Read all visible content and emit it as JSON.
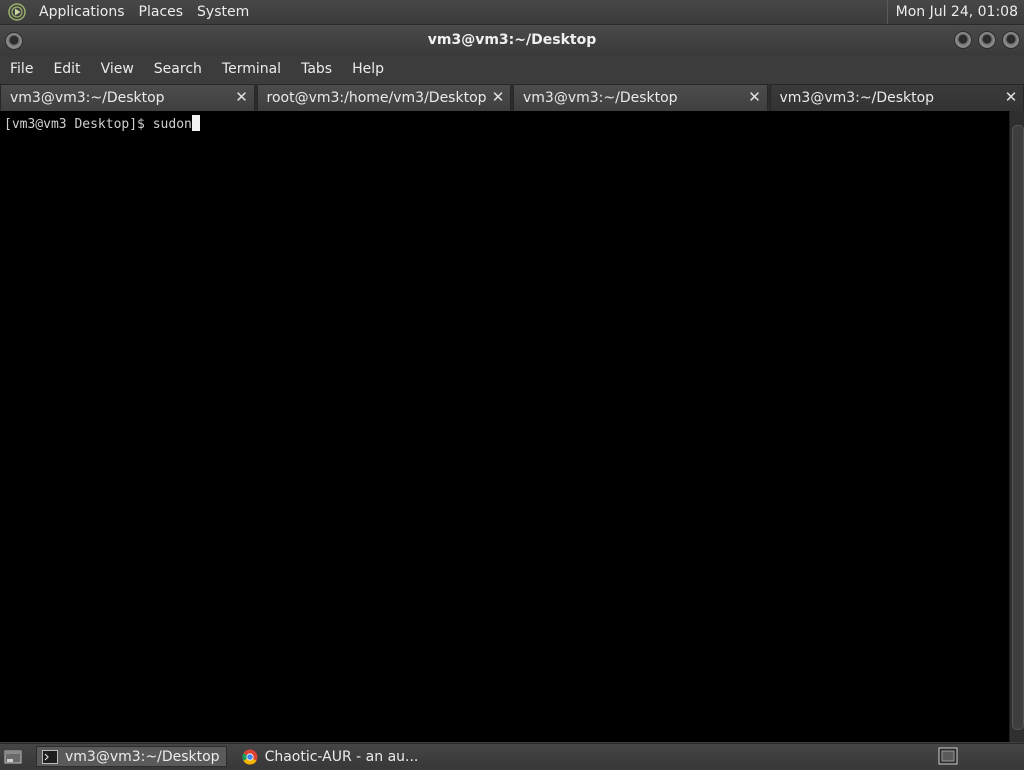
{
  "top_panel": {
    "menus": [
      "Applications",
      "Places",
      "System"
    ],
    "clock": "Mon Jul 24, 01:08"
  },
  "window": {
    "title": "vm3@vm3:~/Desktop"
  },
  "menubar": [
    "File",
    "Edit",
    "View",
    "Search",
    "Terminal",
    "Tabs",
    "Help"
  ],
  "tabs": [
    {
      "label": "vm3@vm3:~/Desktop",
      "active": false
    },
    {
      "label": "root@vm3:/home/vm3/Desktop",
      "active": false
    },
    {
      "label": "vm3@vm3:~/Desktop",
      "active": false
    },
    {
      "label": "vm3@vm3:~/Desktop",
      "active": true
    }
  ],
  "terminal": {
    "prompt": "[vm3@vm3 Desktop]$ ",
    "input": "sudon"
  },
  "taskbar": {
    "tasks": [
      {
        "label": "vm3@vm3:~/Desktop",
        "icon": "terminal-icon",
        "active": true
      },
      {
        "label": "Chaotic-AUR - an au...",
        "icon": "chrome-icon",
        "active": false
      }
    ]
  },
  "colors": {
    "panel_bg": "#3c3c3c",
    "terminal_bg": "#000000",
    "text": "#ececec"
  }
}
